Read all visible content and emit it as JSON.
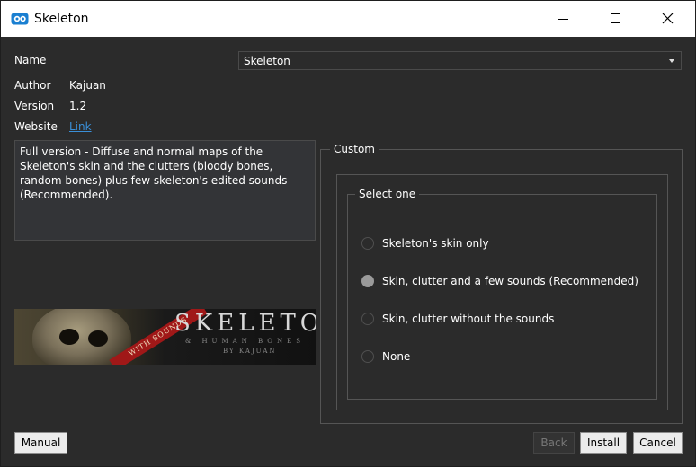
{
  "window": {
    "title": "Skeleton",
    "app_icon": "app-logo-icon",
    "controls": [
      "minimize-icon",
      "maximize-icon",
      "close-icon"
    ]
  },
  "fields": {
    "name_label": "Name",
    "name_value": "Skeleton",
    "author_label": "Author",
    "author_value": "Kajuan",
    "version_label": "Version",
    "version_value": "1.2",
    "website_label": "Website",
    "website_link": "Link"
  },
  "description": "Full version - Diffuse and normal maps of the Skeleton's skin and the clutters (bloody bones, random bones) plus few skeleton's edited sounds (Recommended).",
  "banner": {
    "title": "SKELETON",
    "subtitle": "& HUMAN BONES",
    "byline": "BY KAJUAN",
    "ribbon": "WITH SOUNDS"
  },
  "custom": {
    "group_title": "Custom",
    "select_title": "Select one",
    "options": [
      {
        "label": "Skeleton's skin only",
        "checked": false
      },
      {
        "label": "Skin, clutter and a few sounds (Recommended)",
        "checked": true
      },
      {
        "label": "Skin, clutter without the sounds",
        "checked": false
      },
      {
        "label": "None",
        "checked": false
      }
    ]
  },
  "buttons": {
    "manual": "Manual",
    "back": "Back",
    "install": "Install",
    "cancel": "Cancel"
  },
  "colors": {
    "background": "#2b2b2b",
    "link": "#3a8fd8",
    "titlebar": "#ffffff"
  }
}
